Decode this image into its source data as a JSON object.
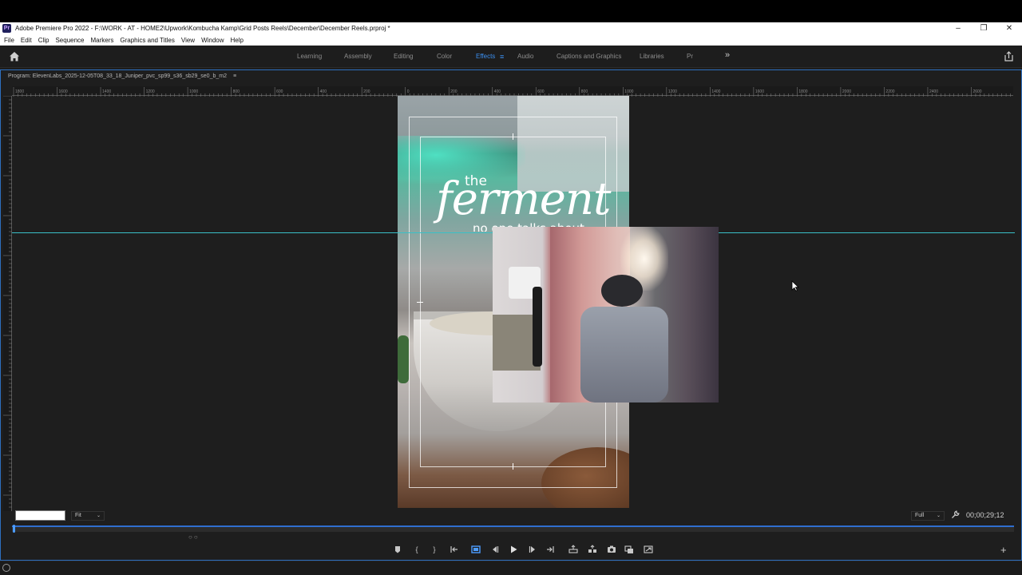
{
  "window": {
    "title": "Adobe Premiere Pro 2022 - F:\\WORK - AT - HOME2\\Upwork\\Kombucha Kamp\\Grid Posts Reels\\December\\December Reels.prproj *",
    "app_badge": "Pr",
    "controls": [
      "minimize-icon",
      "restore-icon",
      "close-icon"
    ]
  },
  "menu": [
    "File",
    "Edit",
    "Clip",
    "Sequence",
    "Markers",
    "Graphics and Titles",
    "View",
    "Window",
    "Help"
  ],
  "workspaces": {
    "tabs": [
      {
        "label": "Learning",
        "active": false
      },
      {
        "label": "Assembly",
        "active": false
      },
      {
        "label": "Editing",
        "active": false
      },
      {
        "label": "Color",
        "active": false
      },
      {
        "label": "Effects",
        "active": true
      },
      {
        "label": "Audio",
        "active": false
      },
      {
        "label": "Captions and Graphics",
        "active": false
      },
      {
        "label": "Libraries",
        "active": false
      },
      {
        "label": "Pr",
        "active": false
      }
    ],
    "more_icon": "»",
    "menu_icon": "≡",
    "accent": "#3b8ff0"
  },
  "program": {
    "title": "Program: ElevenLabs_2025-12-05T08_33_18_Juniper_pvc_sp99_s36_sb29_se0_b_m2",
    "menu_icon": "≡",
    "ruler_labels": [
      "1800",
      "1600",
      "1400",
      "1200",
      "1000",
      "800",
      "600",
      "400",
      "200",
      "0",
      "200",
      "400",
      "600",
      "800",
      "1000",
      "1200",
      "1400",
      "1600",
      "1800",
      "2000",
      "2200",
      "2400",
      "2600"
    ],
    "overlay_text": {
      "the": "the",
      "ferment": "ferment",
      "subtitle": "no one talks about"
    },
    "guide_color": "#39c0c7",
    "zoom": "Fit",
    "resolution": "Full",
    "timecode": "00;00;29;12",
    "timecode_field": ""
  },
  "transport": {
    "buttons": [
      "add-marker-icon",
      "mark-in-icon",
      "mark-out-icon",
      "go-to-in-icon",
      "safe-margins-icon",
      "step-back-icon",
      "play-icon",
      "step-forward-icon",
      "go-to-out-icon",
      "lift-icon",
      "extract-icon",
      "export-frame-icon",
      "insert-icon",
      "overwrite-icon"
    ],
    "add_button": "+"
  }
}
